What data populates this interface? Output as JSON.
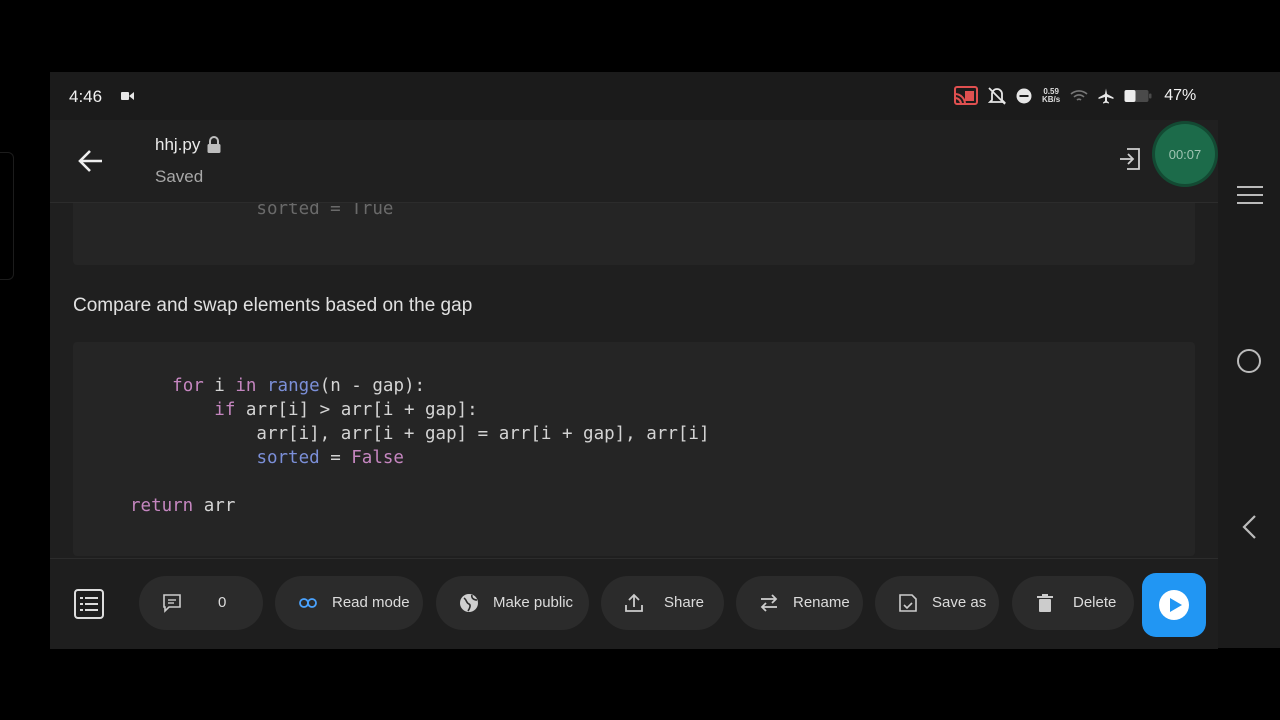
{
  "status_bar": {
    "time": "4:46",
    "net_speed_value": "0.59",
    "net_speed_unit": "KB/s",
    "battery": "47%"
  },
  "app_bar": {
    "filename": "hhj.py",
    "status": "Saved",
    "timer": "00:07"
  },
  "content": {
    "prev_code_tail": "            sorted = True",
    "section_heading": "Compare and swap elements based on the gap"
  },
  "toolbar": {
    "comments_count": "0",
    "read_mode": "Read mode",
    "make_public": "Make public",
    "share": "Share",
    "rename": "Rename",
    "save_as": "Save as",
    "delete": "Delete"
  },
  "colors": {
    "accent_play": "#2196f3",
    "timer_bg": "#1c6b4a",
    "keyword": "#c586c0",
    "builtin": "#7b8fd8"
  },
  "icons": [
    "video-camera-icon",
    "cast-icon",
    "mute-icon",
    "dnd-icon",
    "wifi-icon",
    "airplane-icon",
    "battery-icon",
    "back-arrow-icon",
    "lock-icon",
    "exit-icon",
    "list-icon",
    "comment-icon",
    "link-icon",
    "globe-icon",
    "upload-icon",
    "swap-icon",
    "save-as-icon",
    "trash-icon",
    "play-icon",
    "menu-icon",
    "home-icon",
    "back-nav-icon"
  ]
}
